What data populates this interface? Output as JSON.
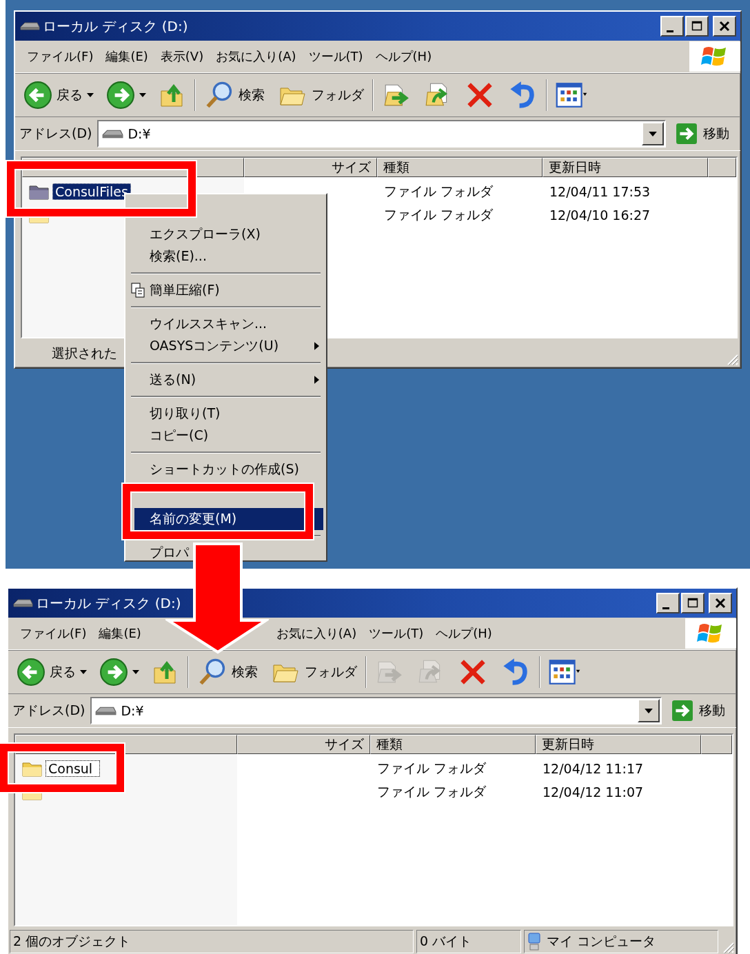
{
  "windows": [
    {
      "title": "ローカル ディスク (D:)",
      "menu": [
        "ファイル(F)",
        "編集(E)",
        "表示(V)",
        "お気に入り(A)",
        "ツール(T)",
        "ヘルプ(H)"
      ],
      "toolbar": {
        "back": "戻る",
        "search": "検索",
        "folders": "フォルダ",
        "move_copy_enabled": true
      },
      "address": {
        "label": "アドレス(D)",
        "value": "D:¥",
        "go": "移動"
      },
      "columns": [
        {
          "label": "サイズ"
        },
        {
          "label": "種類"
        },
        {
          "label": "更新日時"
        }
      ],
      "rows": [
        {
          "name": "ConsulFiles",
          "type": "ファイル フォルダ",
          "modified": "12/04/11 17:53",
          "selected": true,
          "renaming": false
        },
        {
          "type": "ファイル フォルダ",
          "modified": "12/04/10 16:27",
          "selected": false
        }
      ],
      "status": [
        {
          "kind": "text",
          "text": "選択された"
        }
      ]
    },
    {
      "title": "ローカル ディスク (D:)",
      "menu": [
        "ファイル(F)",
        "編集(E)",
        "お気に入り(A)",
        "ツール(T)",
        "ヘルプ(H)"
      ],
      "toolbar": {
        "back": "戻る",
        "search": "検索",
        "folders": "フォルダ",
        "move_copy_enabled": false
      },
      "address": {
        "label": "アドレス(D)",
        "value": "D:¥",
        "go": "移動"
      },
      "columns": [
        {
          "label": "サイズ"
        },
        {
          "label": "種類"
        },
        {
          "label": "更新日時"
        }
      ],
      "rows": [
        {
          "name": "Consul",
          "type": "ファイル フォルダ",
          "modified": "12/04/12 11:17",
          "selected": false,
          "renaming": true
        },
        {
          "type": "ファイル フォルダ",
          "modified": "12/04/12 11:07",
          "selected": false
        }
      ],
      "status": [
        {
          "kind": "text",
          "text": "2 個のオブジェクト"
        },
        {
          "kind": "text",
          "text": "0 バイト"
        },
        {
          "kind": "computer",
          "text": "マイ コンピュータ"
        }
      ]
    }
  ],
  "context_menu": {
    "items": [
      {
        "kind": "gap"
      },
      {
        "kind": "item",
        "label": "エクスプローラ(X)",
        "bold": false,
        "has_icon": false,
        "submenu": false,
        "selected": false
      },
      {
        "kind": "item",
        "label": "検索(E)...",
        "bold": false,
        "has_icon": false,
        "submenu": false,
        "selected": false
      },
      {
        "kind": "separator"
      },
      {
        "kind": "item",
        "label": "簡単圧縮(F)",
        "bold": false,
        "has_icon": true,
        "submenu": false,
        "selected": false
      },
      {
        "kind": "separator"
      },
      {
        "kind": "item",
        "label": "ウイルススキャン...",
        "bold": false,
        "has_icon": false,
        "submenu": false,
        "selected": false
      },
      {
        "kind": "item",
        "label": "OASYSコンテンツ(U)",
        "bold": false,
        "has_icon": false,
        "submenu": true,
        "selected": false
      },
      {
        "kind": "separator"
      },
      {
        "kind": "item",
        "label": "送る(N)",
        "bold": false,
        "has_icon": false,
        "submenu": true,
        "selected": false
      },
      {
        "kind": "separator"
      },
      {
        "kind": "item",
        "label": "切り取り(T)",
        "bold": false,
        "has_icon": false,
        "submenu": false,
        "selected": false
      },
      {
        "kind": "item",
        "label": "コピー(C)",
        "bold": false,
        "has_icon": false,
        "submenu": false,
        "selected": false
      },
      {
        "kind": "separator"
      },
      {
        "kind": "item",
        "label": "ショートカットの作成(S)",
        "bold": false,
        "has_icon": false,
        "submenu": false,
        "selected": false
      },
      {
        "kind": "gap"
      },
      {
        "kind": "item",
        "label": "名前の変更(M)",
        "bold": false,
        "has_icon": false,
        "submenu": false,
        "selected": true
      },
      {
        "kind": "separator"
      },
      {
        "kind": "item",
        "label": "プロパ",
        "bold": false,
        "has_icon": false,
        "submenu": false,
        "selected": false
      }
    ]
  }
}
